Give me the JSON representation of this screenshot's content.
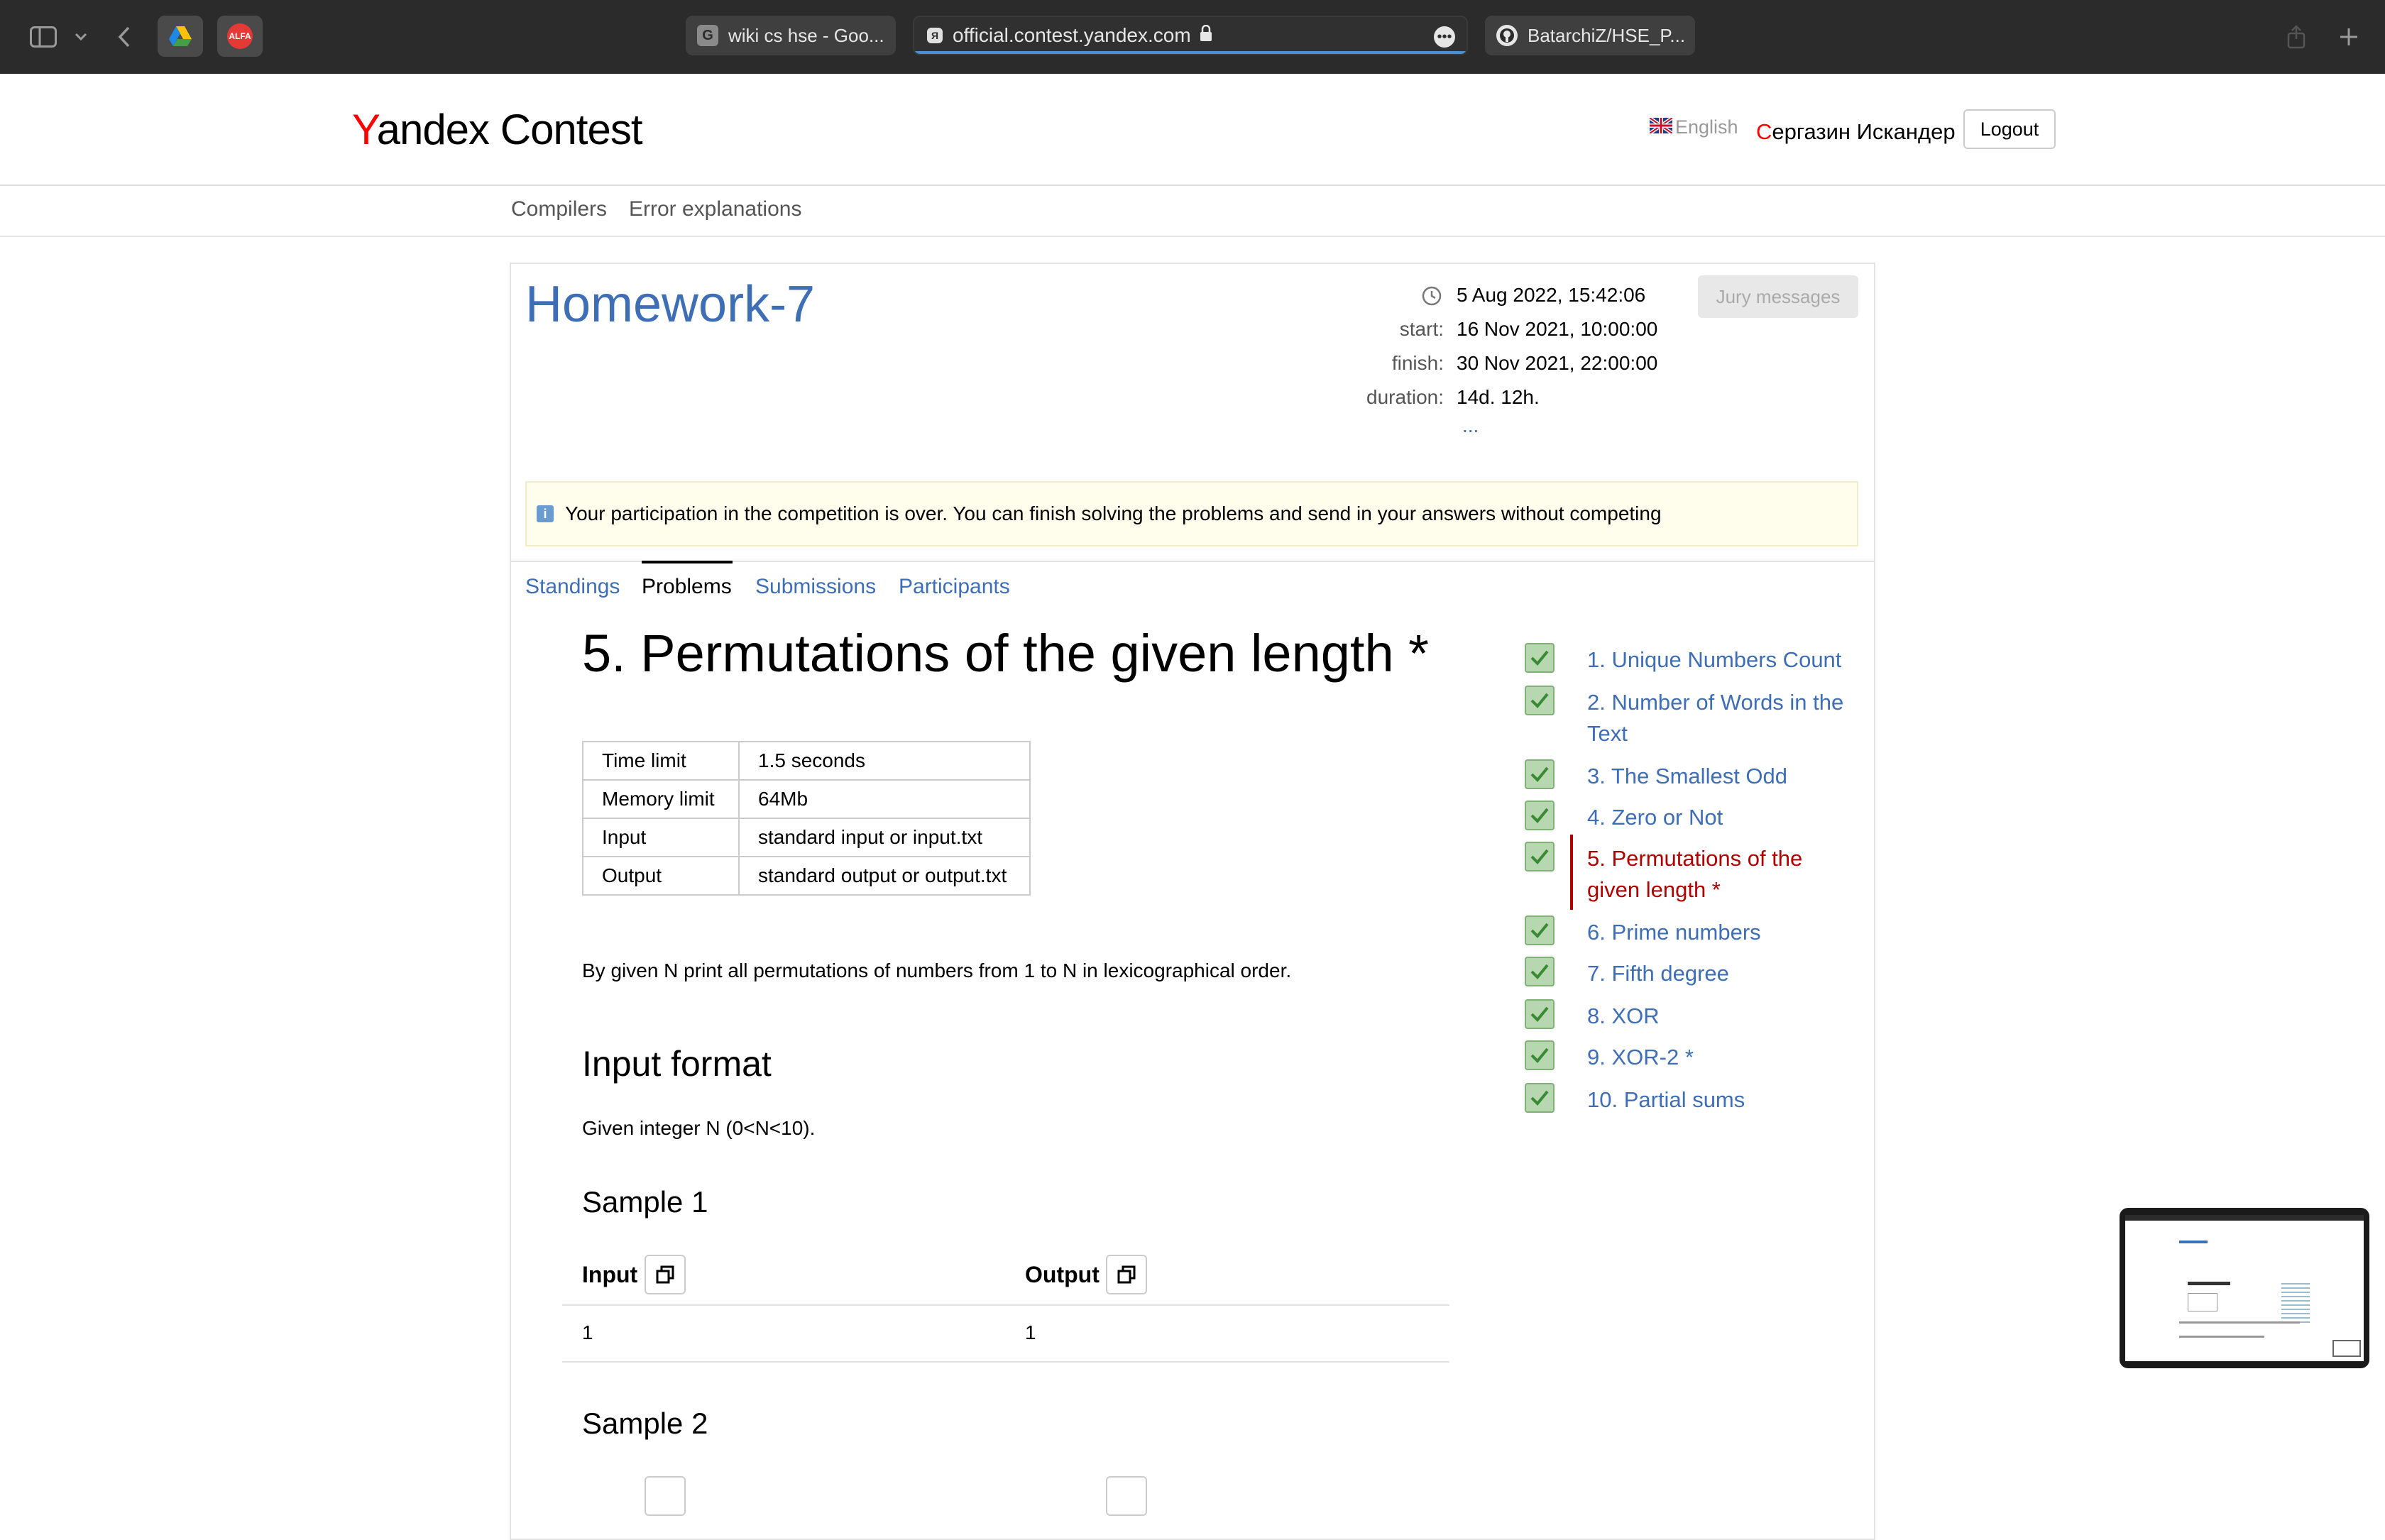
{
  "browser": {
    "tabs": [
      {
        "favicon": "G",
        "label": "wiki cs hse - Goo..."
      },
      {
        "favicon": "Я",
        "label": "official.contest.yandex.com"
      },
      {
        "favicon": "gh",
        "label": "BatarchiZ/HSE_P..."
      }
    ],
    "extensions": [
      "google-drive-icon",
      "alfa-icon"
    ],
    "alfa_label": "ALFA"
  },
  "header": {
    "logo_y": "Y",
    "logo_rest": "andex",
    "logo_contest": "Contest",
    "language": "English",
    "user_first_letter": "С",
    "user_rest": "ергазин Искандер",
    "logout_label": "Logout"
  },
  "subnav": {
    "compilers": "Compilers",
    "errors": "Error explanations"
  },
  "contest": {
    "title": "Homework-7",
    "now": "5 Aug 2022, 15:42:06",
    "start_label": "start:",
    "start": "16 Nov 2021, 10:00:00",
    "finish_label": "finish:",
    "finish": "30 Nov 2021, 22:00:00",
    "duration_label": "duration:",
    "duration": "14d. 12h.",
    "more": "...",
    "jury_messages": "Jury messages",
    "notice": "Your participation in the competition is over. You can finish solving the problems and send in your answers without competing",
    "tabs": {
      "standings": "Standings",
      "problems": "Problems",
      "submissions": "Submissions",
      "participants": "Participants"
    }
  },
  "problem": {
    "title": "5. Permutations of the given length *",
    "limits": [
      {
        "label": "Time limit",
        "value": "1.5 seconds"
      },
      {
        "label": "Memory limit",
        "value": "64Mb"
      },
      {
        "label": "Input",
        "value": "standard input or input.txt"
      },
      {
        "label": "Output",
        "value": "standard output or output.txt"
      }
    ],
    "statement": "By given N print all permutations of numbers from 1 to N in lexicographical order.",
    "input_format_heading": "Input format",
    "input_format_text": "Given integer N (0<N<10).",
    "sample1_heading": "Sample 1",
    "sample_input_label": "Input",
    "sample_output_label": "Output",
    "sample1_input": "1",
    "sample1_output": "1",
    "sample2_heading": "Sample 2"
  },
  "problem_list": [
    {
      "label": "1. Unique Numbers Count"
    },
    {
      "label": "2. Number of Words in the Text"
    },
    {
      "label": "3. The Smallest Odd"
    },
    {
      "label": "4. Zero or Not"
    },
    {
      "label": "5. Permutations of the given length *"
    },
    {
      "label": "6. Prime numbers"
    },
    {
      "label": "7. Fifth degree"
    },
    {
      "label": "8. XOR"
    },
    {
      "label": "9. XOR-2 *"
    },
    {
      "label": "10. Partial sums"
    }
  ]
}
